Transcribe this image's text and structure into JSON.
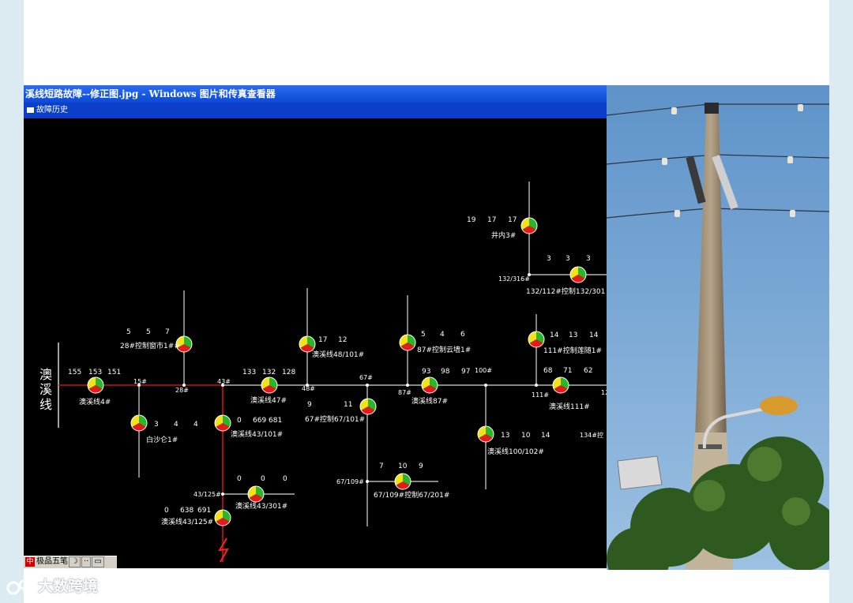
{
  "window": {
    "title": "溪线短路故障--修正图.jpg - Windows 图片和传真查看器",
    "menu_label": "故障历史"
  },
  "diagram": {
    "line_title": "澳溪线",
    "nodes": [
      {
        "label": "澳溪线4#",
        "readings": [
          "155",
          "153",
          "151"
        ]
      },
      {
        "label": "28#控制窗市1##",
        "readings": [
          "5",
          "5",
          "7"
        ]
      },
      {
        "label": "白沙仑1#",
        "readings": [
          "3",
          "4",
          "4"
        ]
      },
      {
        "label": "澳溪线43/101#",
        "readings": [
          "0",
          "669",
          "681"
        ]
      },
      {
        "label": "澳溪线43/125#",
        "readings": [
          "0",
          "638",
          "691"
        ]
      },
      {
        "label": "澳溪线43/301#",
        "readings": [
          "0",
          "0",
          "0"
        ]
      },
      {
        "label": "澳溪线47#",
        "readings": [
          "133",
          "132",
          "128"
        ]
      },
      {
        "label": "澳溪线48/101#",
        "readings": [
          "17",
          "12"
        ]
      },
      {
        "label": "67#控制67/101#",
        "readings": [
          "9",
          "11"
        ]
      },
      {
        "label": "67/109#控制67/201#",
        "readings": [
          "7",
          "10",
          "9"
        ]
      },
      {
        "label": "87#控制云墙1#",
        "readings": [
          "5",
          "4",
          "6"
        ]
      },
      {
        "label": "澳溪线87#",
        "readings": [
          "93",
          "98",
          "97"
        ]
      },
      {
        "label": "澳溪线100/102#",
        "readings": [
          "13",
          "10",
          "14"
        ]
      },
      {
        "label": "井内3#",
        "readings": [
          "19",
          "17",
          "17"
        ]
      },
      {
        "label": "132/112#控制132/301",
        "readings": [
          "3",
          "3",
          "3"
        ]
      },
      {
        "label": "111#控制莲随1#",
        "readings": [
          "14",
          "13",
          "14"
        ]
      },
      {
        "label": "澳溪线111#",
        "readings": [
          "68",
          "71",
          "62"
        ]
      }
    ],
    "point_labels": [
      "15#",
      "28#",
      "43#",
      "48#",
      "67#",
      "87#",
      "100#",
      "111#",
      "132/316#",
      "43/125#",
      "67/109#",
      "134#控",
      "12"
    ],
    "colors": {
      "fault_line": "#cc1111",
      "line": "#d8d8d8",
      "red": "#e21b1b",
      "green": "#2bb52b",
      "yellow": "#f2e21a"
    }
  },
  "taskbar": {
    "ime_label": "极品五笔",
    "moon": "☽",
    "dots": "··"
  },
  "watermark": {
    "text": "大数跨境"
  }
}
